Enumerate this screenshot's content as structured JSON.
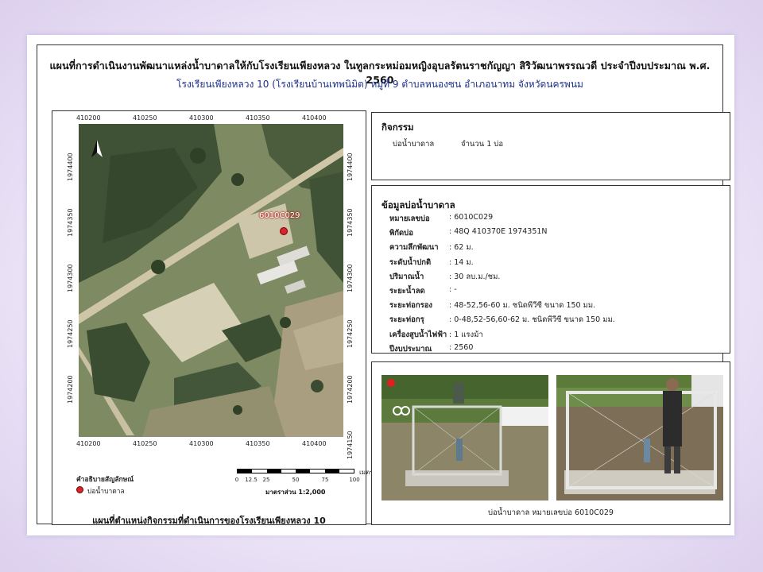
{
  "header": {
    "title": "แผนที่การดำเนินงานพัฒนาแหล่งน้ำบาดาลให้กับโรงเรียนเพียงหลวง ในทูลกระหม่อมหญิงอุบลรัตนราชกัญญา สิริวัฒนาพรรณวดี ประจำปีงบประมาณ พ.ศ. 2560",
    "subtitle": "โรงเรียนเพียงหลวง 10 (โรงเรียนบ้านเทพนิมิต) หมู่ที่ 9 ตำบลหนองซน อำเภอนาทม จังหวัดนครพนม"
  },
  "map": {
    "x_ticks": [
      "410200",
      "410250",
      "410300",
      "410350",
      "410400"
    ],
    "y_ticks": [
      "1974400",
      "1974350",
      "1974300",
      "1974250",
      "1974200",
      "1974150"
    ],
    "well_label": "6010C029",
    "legend_title": "คำอธิบายสัญลักษณ์",
    "legend_item": "บ่อน้ำบาดาล",
    "scale_ticks": [
      "0",
      "12.5",
      "25",
      "50",
      "75",
      "100"
    ],
    "scale_unit": "เมตร",
    "scale_ratio": "มาตราส่วน 1:2,000",
    "caption": "แผนที่ตำแหน่งกิจกรรมที่ดำเนินการของโรงเรียนเพียงหลวง 10",
    "colors": {
      "well": "#d7262b"
    }
  },
  "activity": {
    "title": "กิจกรรม",
    "item": "บ่อน้ำบาดาล",
    "count": "จำนวน 1 บ่อ"
  },
  "well_info": {
    "title": "ข้อมูลบ่อน้ำบาดาล",
    "rows": [
      {
        "key": "หมายเลขบ่อ",
        "value": ": 6010C029"
      },
      {
        "key": "พิกัดบ่อ",
        "value": ": 48Q 410370E 1974351N"
      },
      {
        "key": "ความลึกพัฒนา",
        "value": ": 62 ม."
      },
      {
        "key": "ระดับน้ำปกติ",
        "value": ": 14 ม."
      },
      {
        "key": "ปริมาณน้ำ",
        "value": ": 30 ลบ.ม./ชม."
      },
      {
        "key": "ระยะน้ำลด",
        "value": ": -"
      },
      {
        "key": "ระยะท่อกรอง",
        "value": ": 48-52,56-60 ม. ชนิดพีวีซี  ขนาด 150 มม."
      },
      {
        "key": "ระยะท่อกรุ",
        "value": ": 0-48,52-56,60-62 ม. ชนิดพีวีซี  ขนาด 150 มม."
      },
      {
        "key": "เครื่องสูบน้ำไฟฟ้า",
        "value": ": 1 แรงม้า"
      },
      {
        "key": "ปีงบประมาณ",
        "value": ":  2560"
      }
    ]
  },
  "photos": {
    "caption": "บ่อน้ำบาดาล หมายเลขบ่อ 6010C029"
  }
}
